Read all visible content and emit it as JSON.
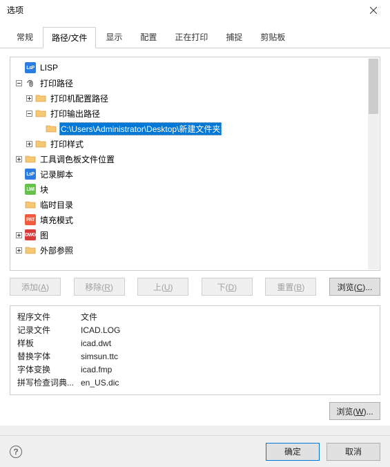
{
  "window": {
    "title": "选项"
  },
  "tabs": {
    "items": [
      {
        "label": "常规"
      },
      {
        "label": "路径/文件",
        "active": true
      },
      {
        "label": "显示"
      },
      {
        "label": "配置"
      },
      {
        "label": "正在打印"
      },
      {
        "label": "捕捉"
      },
      {
        "label": "剪贴板"
      }
    ]
  },
  "tree": {
    "lisp": "LISP",
    "print_path": "打印路径",
    "printer_config": "打印机配置路径",
    "print_output": "打印输出路径",
    "selected_path": "C:\\Users\\Administrator\\Desktop\\新建文件夹",
    "print_style": "打印样式",
    "tool_palette": "工具调色板文件位置",
    "record_script": "记录脚本",
    "block": "块",
    "temp_dir": "临时目录",
    "fill_pattern": "填充模式",
    "drawing": "图",
    "external_ref": "外部参照"
  },
  "buttons": {
    "add": "添加(A)",
    "remove": "移除(R)",
    "up": "上(U)",
    "down": "下(D)",
    "reset": "重置(B)",
    "browse": "浏览(C)...",
    "browse2": "浏览(W)...",
    "ok": "确定",
    "cancel": "取消",
    "help": "?"
  },
  "properties": {
    "rows": [
      {
        "key": "程序文件",
        "value": "文件"
      },
      {
        "key": "记录文件",
        "value": "ICAD.LOG"
      },
      {
        "key": "样板",
        "value": "icad.dwt"
      },
      {
        "key": "替换字体",
        "value": "simsun.ttc"
      },
      {
        "key": "字体变换",
        "value": "icad.fmp"
      },
      {
        "key": "拼写检查词典...",
        "value": "en_US.dic"
      }
    ]
  },
  "colors": {
    "lsp": "#2b7de1",
    "lwi": "#66c24a",
    "pat": "#f25b3d",
    "dwg": "#d93b3b",
    "selection": "#0078d7",
    "folder1": "#f7c873",
    "folder2": "#e6a43a"
  }
}
